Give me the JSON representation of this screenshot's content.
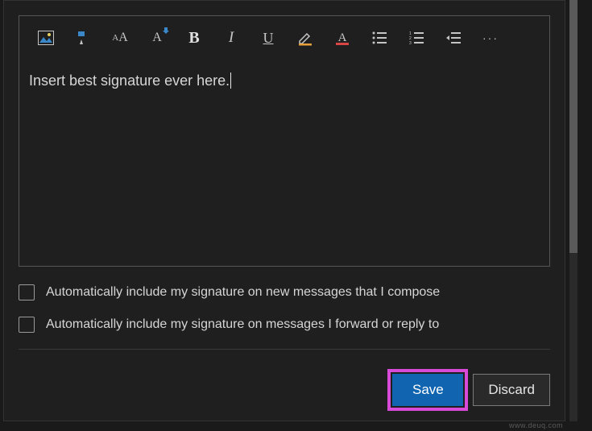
{
  "toolbar": {
    "icons": [
      "insert-image-icon",
      "format-painter-icon",
      "font-size-icon",
      "font-size-decrease-icon",
      "bold-icon",
      "italic-icon",
      "underline-icon",
      "highlight-icon",
      "font-color-icon",
      "bulleted-list-icon",
      "numbered-list-icon",
      "outdent-icon",
      "more-icon"
    ]
  },
  "editor": {
    "content": "Insert best signature ever here."
  },
  "options": {
    "newMessages": "Automatically include my signature on new messages that I compose",
    "forwardReply": "Automatically include my signature on messages I forward or reply to"
  },
  "buttons": {
    "save": "Save",
    "discard": "Discard"
  },
  "watermark": "www.deuq.com",
  "colors": {
    "highlight_accent": "#d84ad8",
    "primary_button": "#1064b0",
    "underline_accent": "#e8a13a",
    "fontcolor_accent": "#d84545"
  }
}
